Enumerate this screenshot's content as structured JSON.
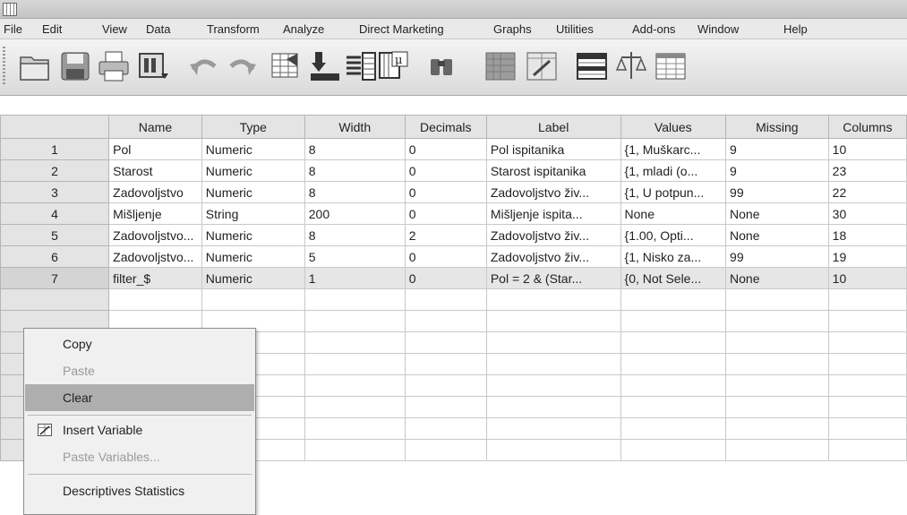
{
  "menubar": {
    "items": [
      "File",
      "Edit",
      "View",
      "Data",
      "Transform",
      "Analyze",
      "Direct Marketing",
      "Graphs",
      "Utilities",
      "Add-ons",
      "Window",
      "Help"
    ]
  },
  "toolbar": {
    "icons": [
      "open-folder-icon",
      "save-icon",
      "print-icon",
      "recall-dialog-icon",
      "undo-icon",
      "redo-icon",
      "goto-case-icon",
      "goto-variable-icon",
      "variables-icon",
      "run-descriptives-icon",
      "find-icon",
      "insert-cases-icon",
      "insert-variable-icon",
      "split-file-icon",
      "weight-cases-icon",
      "select-cases-icon"
    ]
  },
  "grid": {
    "columns": [
      "Name",
      "Type",
      "Width",
      "Decimals",
      "Label",
      "Values",
      "Missing",
      "Columns"
    ],
    "rows": [
      {
        "num": "1",
        "cells": [
          "Pol",
          "Numeric",
          "8",
          "0",
          "Pol ispitanika",
          "{1, Muškarc...",
          "9",
          "10"
        ]
      },
      {
        "num": "2",
        "cells": [
          "Starost",
          "Numeric",
          "8",
          "0",
          "Starost ispitanika",
          "{1, mladi (o...",
          "9",
          "23"
        ]
      },
      {
        "num": "3",
        "cells": [
          "Zadovoljstvo",
          "Numeric",
          "8",
          "0",
          "Zadovoljstvo živ...",
          "{1, U potpun...",
          "99",
          "22"
        ]
      },
      {
        "num": "4",
        "cells": [
          "Mišljenje",
          "String",
          "200",
          "0",
          "Mišljenje ispita...",
          "None",
          "None",
          "30"
        ]
      },
      {
        "num": "5",
        "cells": [
          "Zadovoljstvo...",
          "Numeric",
          "8",
          "2",
          "Zadovoljstvo živ...",
          "{1.00, Opti...",
          "None",
          "18"
        ]
      },
      {
        "num": "6",
        "cells": [
          "Zadovoljstvo...",
          "Numeric",
          "5",
          "0",
          "Zadovoljstvo živ...",
          "{1, Nisko za...",
          "99",
          "19"
        ]
      },
      {
        "num": "7",
        "cells": [
          "filter_$",
          "Numeric",
          "1",
          "0",
          "Pol = 2 & (Star...",
          "{0, Not Sele...",
          "None",
          "10"
        ]
      }
    ]
  },
  "context_menu": {
    "copy": "Copy",
    "paste": "Paste",
    "clear": "Clear",
    "insert_variable": "Insert Variable",
    "paste_variables": "Paste Variables...",
    "descriptives": "Descriptives Statistics"
  }
}
